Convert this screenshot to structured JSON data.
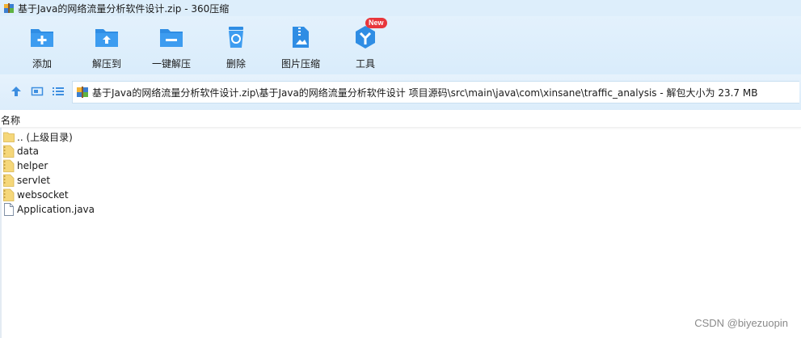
{
  "window": {
    "title": "基于Java的网络流量分析软件设计.zip - 360压缩"
  },
  "toolbar": {
    "items": [
      {
        "label": "添加",
        "icon": "add-icon"
      },
      {
        "label": "解压到",
        "icon": "extract-to-icon"
      },
      {
        "label": "一键解压",
        "icon": "one-click-extract-icon"
      },
      {
        "label": "删除",
        "icon": "delete-icon"
      },
      {
        "label": "图片压缩",
        "icon": "image-compress-icon"
      },
      {
        "label": "工具",
        "icon": "tools-icon",
        "badge": "New"
      }
    ]
  },
  "address": {
    "path": "基于Java的网络流量分析软件设计.zip\\基于Java的网络流量分析软件设计 项目源码\\src\\main\\java\\com\\xinsane\\traffic_analysis - 解包大小为 23.7 MB"
  },
  "list": {
    "column_name": "名称",
    "files": [
      {
        "name": ".. (上级目录)",
        "type": "folder-up"
      },
      {
        "name": "data",
        "type": "folder"
      },
      {
        "name": "helper",
        "type": "folder"
      },
      {
        "name": "servlet",
        "type": "folder"
      },
      {
        "name": "websocket",
        "type": "folder"
      },
      {
        "name": "Application.java",
        "type": "file"
      }
    ]
  },
  "watermark": "CSDN @biyezuopin",
  "colors": {
    "accent": "#2f8de4",
    "toolbar_bg": "#dcedfb",
    "folder": "#f5d77a",
    "badge": "#e8363b"
  }
}
